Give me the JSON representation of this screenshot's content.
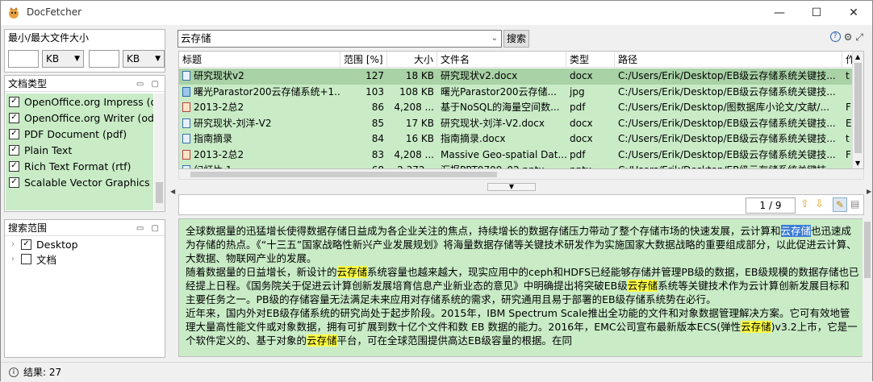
{
  "window": {
    "title": "DocFetcher",
    "min_btn": "—",
    "max_btn": "☐",
    "close_btn": "✕"
  },
  "size_panel": {
    "title": "最小/最大文件大小",
    "min_unit": "KB",
    "max_unit": "KB"
  },
  "type_panel": {
    "title": "文档类型",
    "items": [
      {
        "label": "OpenOffice.org Impress (o"
      },
      {
        "label": "OpenOffice.org Writer (od"
      },
      {
        "label": "PDF Document (pdf)"
      },
      {
        "label": "Plain Text"
      },
      {
        "label": "Rich Text Format (rtf)"
      },
      {
        "label": "Scalable Vector Graphics (s"
      }
    ]
  },
  "scope_panel": {
    "title": "搜索范围",
    "items": [
      {
        "label": "Desktop",
        "checked": "✓"
      },
      {
        "label": "文档",
        "checked": ""
      }
    ]
  },
  "search": {
    "query": "云存储",
    "button": "搜索"
  },
  "table": {
    "columns": [
      "标题",
      "范围 [%]",
      "大小",
      "文件名",
      "类型",
      "路径",
      "作"
    ],
    "rows": [
      {
        "title": "研究现状v2",
        "score": "127",
        "size": "18 KB",
        "filename": "研究现状v2.docx",
        "type": "docx",
        "path": "C:/Users/Erik/Desktop/EB级云存储系统关键技...",
        "extra": "t",
        "icon": "doc"
      },
      {
        "title": "曙光Parastor200云存储系统+1...",
        "score": "103",
        "size": "108 KB",
        "filename": "曙光Parastor200云存储...",
        "type": "jpg",
        "path": "C:/Users/Erik/Desktop/EB级云存储系统关键技...",
        "extra": "",
        "icon": "img"
      },
      {
        "title": "2013-2总2",
        "score": "86",
        "size": "4,208 ...",
        "filename": "基于NoSQL的海量空间数...",
        "type": "pdf",
        "path": "C:/Users/Erik/Desktop/图数据库小论文/文献/...",
        "extra": "F",
        "icon": "pdf"
      },
      {
        "title": "研究现状-刘洋-V2",
        "score": "85",
        "size": "17 KB",
        "filename": "研究现状-刘洋-V2.docx",
        "type": "docx",
        "path": "C:/Users/Erik/Desktop/EB级云存储系统关键技...",
        "extra": "E",
        "icon": "doc"
      },
      {
        "title": "指南摘录",
        "score": "84",
        "size": "16 KB",
        "filename": "指南摘录.docx",
        "type": "docx",
        "path": "C:/Users/Erik/Desktop/EB级云存储系统关键技...",
        "extra": "t",
        "icon": "doc"
      },
      {
        "title": "2013-2总2",
        "score": "83",
        "size": "4,208 ...",
        "filename": "Massive Geo-spatial Dat...",
        "type": "pdf",
        "path": "C:/Users/Erik/Desktop/EB级云存储系统关键技...",
        "extra": "F",
        "icon": "pdf"
      },
      {
        "title": "幻灯片 1",
        "score": "68",
        "size": "2,372...",
        "filename": "汇报PPT0709_02.pptx",
        "type": "pptx",
        "path": "C:/Users/Erik/Desktop/EB级云存储系统关键技...",
        "extra": "",
        "icon": "doc"
      }
    ]
  },
  "pager": {
    "page": "1 / 9"
  },
  "preview": {
    "p1a": "全球数据量的迅猛增长使得数据存储日益成为各企业关注的焦点，持续增长的数据存储压力带动了整个存储市场的快速发展，云计算和",
    "p1h": "云存储",
    "p1b": "也迅速成为存储的热点。《“十三五”国家战略性新兴产业发展规划》将海量数据存储等关键技术研发作为实施国家大数据战略的重要组成部分，以此促进云计算、大数据、物联网产业的发展。",
    "p2a": "随着数据量的日益增长，新设计的",
    "p2h": "云存储",
    "p2b": "系统容量也越来越大，现实应用中的ceph和HDFS已经能够存储并管理PB级的数据，EB级规模的数据存储也已经提上日程。《国务院关于促进云计算创新发展培育信息产业新业态的意见》中明确提出将突破EB级",
    "p2h2": "云存储",
    "p2c": "系统等关键技术作为云计算创新发展目标和主要任务之一。PB级的存储容量无法满足未来应用对存储系统的需求，研究通用且易于部署的EB级存储系统势在必行。",
    "p3a": "近年来，国内外对EB级存储系统的研究尚处于起步阶段。2015年，IBM Spectrum Scale推出全功能的文件和对象数据管理解决方案。它可有效地管理大量高性能文件或对象数据，拥有可扩展到数十亿个文件和数 EB 数据的能力。2016年，EMC公司宣布最新版本ECS(弹性",
    "p3h": "云存储",
    "p3b": ")v3.2上市，它是一个软件定义的、基于对象的",
    "p3h2": "云存储",
    "p3c": "平台，可在全球范围提供高达EB级容量的根据。在同"
  },
  "status": {
    "text": "结果: 27"
  }
}
